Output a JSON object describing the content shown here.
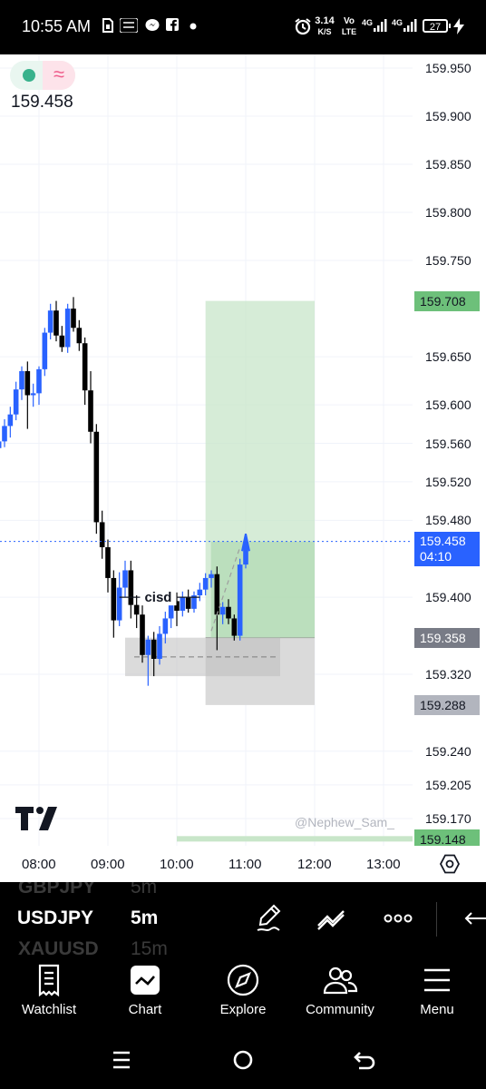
{
  "status_bar": {
    "time": "10:55 AM",
    "net_speed_value": "3.14",
    "net_speed_unit": "K/S",
    "volte_top": "Vo",
    "volte_bottom": "LTE",
    "signal1": "4G",
    "signal2": "4G",
    "battery": "27",
    "icons": [
      "sim-icon",
      "temu-icon",
      "messenger-icon",
      "facebook-icon",
      "dot-icon",
      "alarm-icon",
      "wifi-icon"
    ]
  },
  "chart": {
    "symbol_pill_icons": [
      "market-open-dot-icon",
      "wave-icon"
    ],
    "last_price": "159.458",
    "price_labels": [
      "159.950",
      "159.900",
      "159.850",
      "159.800",
      "159.750",
      "159.650",
      "159.600",
      "159.560",
      "159.520",
      "159.480",
      "159.400",
      "159.320",
      "159.240",
      "159.205",
      "159.170"
    ],
    "price_tags": {
      "target": "159.708",
      "current": "159.458",
      "countdown": "04:10",
      "entry": "159.358",
      "stop": "159.288",
      "bottom": "159.148"
    },
    "tag_colors": {
      "target": "#6dc07a",
      "current": "#2962ff",
      "entry": "#787b86",
      "stop": "#b2b5be",
      "bottom": "#6dc07a"
    },
    "annotation": "cisd",
    "watermark": "@Nephew_Sam_",
    "time_labels": [
      "08:00",
      "09:00",
      "10:00",
      "11:00",
      "12:00",
      "13:00"
    ],
    "up_color": "#2962ff",
    "down_color": "#000000"
  },
  "chart_data": {
    "type": "candlestick",
    "symbol": "USDJPY",
    "timeframe": "5m",
    "ylim": [
      159.14,
      159.96
    ],
    "x_start": "07:25",
    "candles": [
      {
        "o": 159.555,
        "h": 159.568,
        "l": 159.545,
        "c": 159.562
      },
      {
        "o": 159.562,
        "h": 159.585,
        "l": 159.556,
        "c": 159.578
      },
      {
        "o": 159.578,
        "h": 159.598,
        "l": 159.566,
        "c": 159.59
      },
      {
        "o": 159.59,
        "h": 159.624,
        "l": 159.584,
        "c": 159.616
      },
      {
        "o": 159.616,
        "h": 159.64,
        "l": 159.605,
        "c": 159.635
      },
      {
        "o": 159.635,
        "h": 159.645,
        "l": 159.575,
        "c": 159.61
      },
      {
        "o": 159.61,
        "h": 159.622,
        "l": 159.598,
        "c": 159.612
      },
      {
        "o": 159.612,
        "h": 159.64,
        "l": 159.6,
        "c": 159.637
      },
      {
        "o": 159.637,
        "h": 159.68,
        "l": 159.63,
        "c": 159.675
      },
      {
        "o": 159.675,
        "h": 159.705,
        "l": 159.668,
        "c": 159.698
      },
      {
        "o": 159.698,
        "h": 159.708,
        "l": 159.666,
        "c": 159.672
      },
      {
        "o": 159.672,
        "h": 159.682,
        "l": 159.655,
        "c": 159.66
      },
      {
        "o": 159.66,
        "h": 159.705,
        "l": 159.654,
        "c": 159.7
      },
      {
        "o": 159.7,
        "h": 159.712,
        "l": 159.676,
        "c": 159.68
      },
      {
        "o": 159.68,
        "h": 159.688,
        "l": 159.656,
        "c": 159.664
      },
      {
        "o": 159.664,
        "h": 159.67,
        "l": 159.6,
        "c": 159.615
      },
      {
        "o": 159.615,
        "h": 159.635,
        "l": 159.56,
        "c": 159.572
      },
      {
        "o": 159.572,
        "h": 159.58,
        "l": 159.466,
        "c": 159.478
      },
      {
        "o": 159.478,
        "h": 159.49,
        "l": 159.44,
        "c": 159.452
      },
      {
        "o": 159.452,
        "h": 159.46,
        "l": 159.405,
        "c": 159.42
      },
      {
        "o": 159.42,
        "h": 159.428,
        "l": 159.358,
        "c": 159.376
      },
      {
        "o": 159.376,
        "h": 159.426,
        "l": 159.37,
        "c": 159.41
      },
      {
        "o": 159.41,
        "h": 159.438,
        "l": 159.4,
        "c": 159.428
      },
      {
        "o": 159.428,
        "h": 159.438,
        "l": 159.378,
        "c": 159.392
      },
      {
        "o": 159.392,
        "h": 159.402,
        "l": 159.368,
        "c": 159.382
      },
      {
        "o": 159.382,
        "h": 159.4,
        "l": 159.332,
        "c": 159.34
      },
      {
        "o": 159.34,
        "h": 159.36,
        "l": 159.308,
        "c": 159.356
      },
      {
        "o": 159.356,
        "h": 159.364,
        "l": 159.318,
        "c": 159.336
      },
      {
        "o": 159.336,
        "h": 159.37,
        "l": 159.33,
        "c": 159.362
      },
      {
        "o": 159.362,
        "h": 159.385,
        "l": 159.352,
        "c": 159.378
      },
      {
        "o": 159.378,
        "h": 159.4,
        "l": 159.368,
        "c": 159.396
      },
      {
        "o": 159.396,
        "h": 159.405,
        "l": 159.37,
        "c": 159.386
      },
      {
        "o": 159.386,
        "h": 159.406,
        "l": 159.38,
        "c": 159.4
      },
      {
        "o": 159.4,
        "h": 159.408,
        "l": 159.384,
        "c": 159.388
      },
      {
        "o": 159.388,
        "h": 159.406,
        "l": 159.384,
        "c": 159.402
      },
      {
        "o": 159.402,
        "h": 159.415,
        "l": 159.396,
        "c": 159.408
      },
      {
        "o": 159.408,
        "h": 159.425,
        "l": 159.402,
        "c": 159.42
      },
      {
        "o": 159.42,
        "h": 159.428,
        "l": 159.41,
        "c": 159.424
      },
      {
        "o": 159.424,
        "h": 159.432,
        "l": 159.345,
        "c": 159.382
      },
      {
        "o": 159.382,
        "h": 159.395,
        "l": 159.372,
        "c": 159.39
      },
      {
        "o": 159.39,
        "h": 159.398,
        "l": 159.372,
        "c": 159.378
      },
      {
        "o": 159.378,
        "h": 159.382,
        "l": 159.355,
        "c": 159.36
      },
      {
        "o": 159.36,
        "h": 159.44,
        "l": 159.355,
        "c": 159.434
      },
      {
        "o": 159.434,
        "h": 159.464,
        "l": 159.43,
        "c": 159.458
      }
    ],
    "long_position": {
      "entry": 159.358,
      "target": 159.708,
      "stop": 159.288,
      "start": "10:25",
      "end": "12:00"
    },
    "fvg_box": {
      "top": 159.358,
      "bottom": 159.318,
      "start": "09:15",
      "end": "11:30"
    },
    "current_price": 159.458
  },
  "symbol_bar": {
    "prev_symbol": "GBPJPY",
    "prev_tf": "5m",
    "symbol": "USDJPY",
    "timeframe": "5m",
    "next_symbol": "XAUUSD",
    "next_tf": "15m",
    "tools": [
      "pen-tool-icon",
      "trend-line-icon",
      "more-icon",
      "back-arrow-icon"
    ]
  },
  "nav": {
    "items": [
      {
        "label": "Watchlist",
        "icon": "watchlist-icon"
      },
      {
        "label": "Chart",
        "icon": "chart-icon"
      },
      {
        "label": "Explore",
        "icon": "compass-icon"
      },
      {
        "label": "Community",
        "icon": "community-icon"
      },
      {
        "label": "Menu",
        "icon": "menu-icon"
      }
    ]
  }
}
